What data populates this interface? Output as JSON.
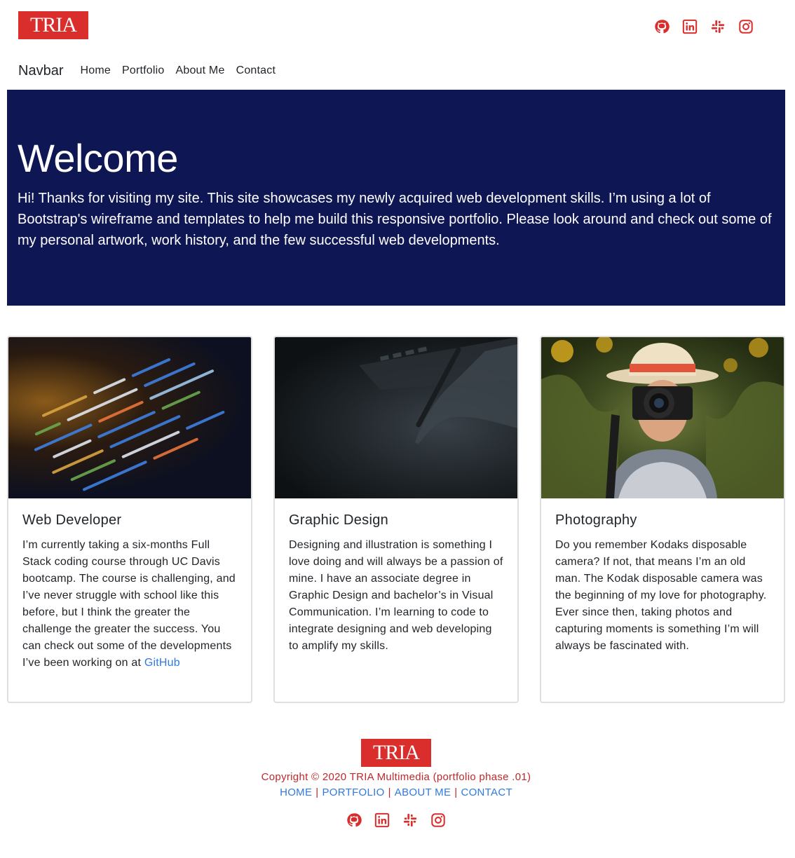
{
  "header": {
    "logo_text": "TRIA",
    "social": [
      {
        "icon": "github-icon",
        "label": "GitHub"
      },
      {
        "icon": "linkedin-icon",
        "label": "LinkedIn"
      },
      {
        "icon": "slack-icon",
        "label": "Slack"
      },
      {
        "icon": "instagram-icon",
        "label": "Instagram"
      }
    ]
  },
  "navbar": {
    "brand": "Navbar",
    "links": [
      "Home",
      "Portfolio",
      "About Me",
      "Contact"
    ]
  },
  "jumbotron": {
    "title": "Welcome",
    "text": "Hi! Thanks for visiting my site. This site showcases my newly acquired web development skills. I’m using a lot of Bootstrap's wireframe and templates to help me build this responsive portfolio. Please look around and check out some of my personal artwork, work history, and the few successful web developments."
  },
  "cards": [
    {
      "title": "Web Developer",
      "text": "I’m currently taking a six-months Full Stack coding course through UC Davis bootcamp. The course is challenging, and I’ve never struggle with school like this before, but I think the greater the challenge the greater the success. You can check out some of the developments I’ve been working on at",
      "link": "GitHub",
      "image": "code-screen"
    },
    {
      "title": "Graphic Design",
      "text": "Designing and illustration is something I love doing and will always be a passion of mine. I have an associate degree in Graphic Design and bachelor’s in Visual Communication. I’m learning to code to integrate designing and web developing to amplify my skills.",
      "image": "drawing-tablet"
    },
    {
      "title": "Photography",
      "text": "Do you remember Kodaks disposable camera? If not, that means I’m an old man. The Kodak disposable camera was the beginning of my love for photography. Ever since then, taking photos and capturing moments is something I’m will always be fascinated with.",
      "image": "photographer"
    }
  ],
  "footer": {
    "logo_text": "TRIA",
    "copyright": "Copyright © 2020 TRIA Multimedia (portfolio phase .01)",
    "links": [
      "HOME",
      "PORTFOLIO",
      "ABOUT ME",
      "CONTACT"
    ],
    "separator": "|"
  },
  "colors": {
    "brand_red": "#da2e2c",
    "jumbotron_bg": "#0e1653",
    "link_blue": "#2f7ae0"
  }
}
